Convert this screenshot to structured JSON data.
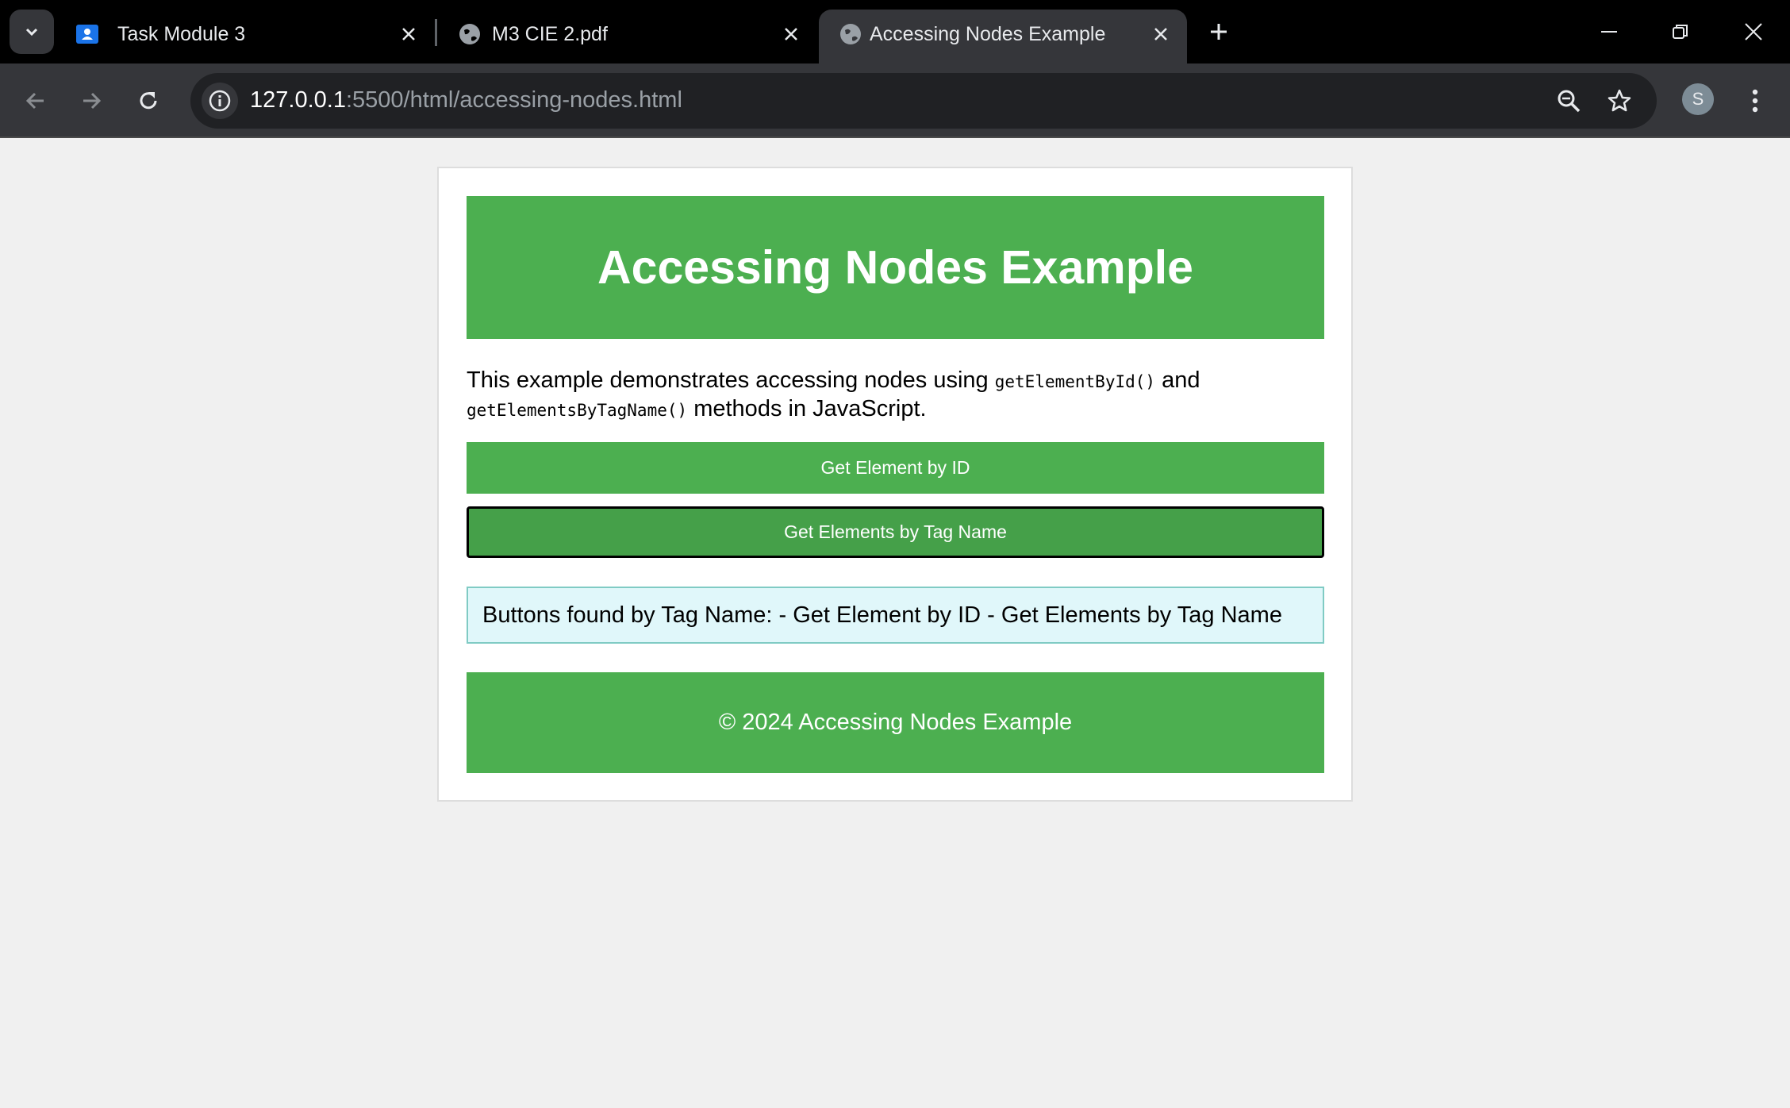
{
  "browser": {
    "tabs": [
      {
        "title": "Task Module 3",
        "icon": "classroom-icon",
        "active": false
      },
      {
        "title": "M3 CIE 2.pdf",
        "icon": "globe-icon",
        "active": false
      },
      {
        "title": "Accessing Nodes Example",
        "icon": "globe-icon",
        "active": true
      }
    ],
    "url_host": "127.0.0.1",
    "url_path": ":5500/html/accessing-nodes.html",
    "profile_initial": "S"
  },
  "page": {
    "header_title": "Accessing Nodes Example",
    "description_prefix": "This example demonstrates accessing nodes using ",
    "code_by_id": "getElementById()",
    "description_and": " and",
    "code_by_tag": "getElementsByTagName()",
    "description_suffix": " methods in JavaScript.",
    "button_by_id": "Get Element by ID",
    "button_by_tag": "Get Elements by Tag Name",
    "output_text": "Buttons found by Tag Name: - Get Element by ID - Get Elements by Tag Name",
    "footer_text": "© 2024 Accessing Nodes Example"
  },
  "colors": {
    "accent_green": "#4caf50",
    "output_bg": "#e0f7fa",
    "page_bg": "#f0f0f0"
  }
}
